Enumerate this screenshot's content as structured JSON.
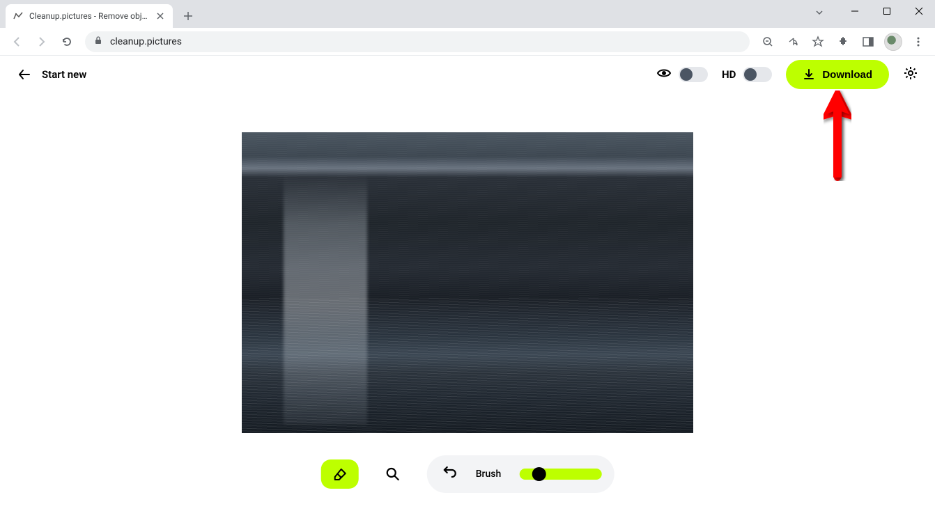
{
  "browser": {
    "tab_title": "Cleanup.pictures - Remove objec",
    "url": "cleanup.pictures"
  },
  "header": {
    "start_new": "Start new",
    "hd_label": "HD",
    "download_label": "Download"
  },
  "toolbar": {
    "brush_label": "Brush"
  },
  "colors": {
    "accent": "#bdff00",
    "arrow": "#ff0000"
  }
}
